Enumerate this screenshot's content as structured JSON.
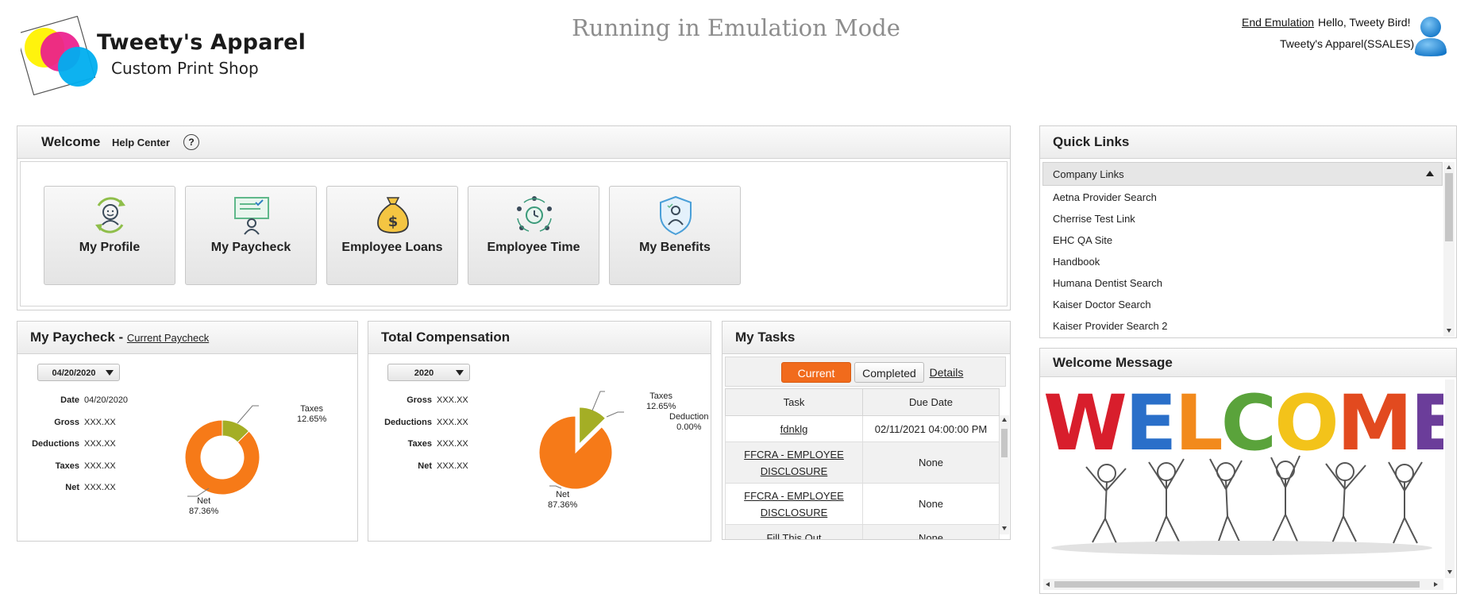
{
  "header": {
    "logo_title": "Tweety's Apparel",
    "logo_subtitle": "Custom Print Shop",
    "emulation_banner": "Running in Emulation Mode",
    "end_emulation": "End Emulation",
    "greeting": "Hello, Tweety Bird!",
    "company": "Tweety's Apparel(SSALES)"
  },
  "welcome": {
    "title": "Welcome",
    "help_center": "Help Center",
    "help_icon_glyph": "?",
    "tiles": [
      {
        "label": "My Profile",
        "icon": "profile-icon"
      },
      {
        "label": "My Paycheck",
        "icon": "paycheck-icon"
      },
      {
        "label": "Employee Loans",
        "icon": "money-bag-icon"
      },
      {
        "label": "Employee Time",
        "icon": "clock-team-icon"
      },
      {
        "label": "My Benefits",
        "icon": "shield-person-icon"
      }
    ]
  },
  "paycheck": {
    "title": "My Paycheck - ",
    "link": "Current Paycheck",
    "selected_date": "04/20/2020",
    "rows": [
      {
        "label": "Date",
        "value": "04/20/2020"
      },
      {
        "label": "Gross",
        "value": "XXX.XX"
      },
      {
        "label": "Deductions",
        "value": "XXX.XX"
      },
      {
        "label": "Taxes",
        "value": "XXX.XX"
      },
      {
        "label": "Net",
        "value": "XXX.XX"
      }
    ]
  },
  "compensation": {
    "title": "Total Compensation",
    "selected_year": "2020",
    "rows": [
      {
        "label": "Gross",
        "value": "XXX.XX"
      },
      {
        "label": "Deductions",
        "value": "XXX.XX"
      },
      {
        "label": "Taxes",
        "value": "XXX.XX"
      },
      {
        "label": "Net",
        "value": "XXX.XX"
      }
    ]
  },
  "chart_data": [
    {
      "type": "pie",
      "variant": "donut",
      "slices": [
        {
          "label": "Taxes",
          "value": 12.65,
          "display": "12.65%",
          "color": "#a4ae25"
        },
        {
          "label": "Net",
          "value": 87.36,
          "display": "87.36%",
          "color": "#f67a18"
        }
      ]
    },
    {
      "type": "pie",
      "variant": "exploded",
      "slices": [
        {
          "label": "Taxes",
          "value": 12.65,
          "display": "12.65%",
          "color": "#a4ae25"
        },
        {
          "label": "Deduction",
          "value": 0.0,
          "display": "0.00%",
          "color": "#2d2d2d"
        },
        {
          "label": "Net",
          "value": 87.36,
          "display": "87.36%",
          "color": "#f67a18"
        }
      ]
    }
  ],
  "tasks": {
    "title": "My Tasks",
    "tab_current": "Current",
    "tab_completed": "Completed",
    "details_link": "Details",
    "columns": [
      "Task",
      "Due Date"
    ],
    "rows": [
      {
        "task": "fdnklg",
        "due": "02/11/2021 04:00:00 PM"
      },
      {
        "task": "FFCRA - EMPLOYEE DISCLOSURE",
        "due": "None"
      },
      {
        "task": "FFCRA - EMPLOYEE DISCLOSURE",
        "due": "None"
      },
      {
        "task": "Fill This Out",
        "due": "None"
      }
    ]
  },
  "quick_links": {
    "title": "Quick Links",
    "group": "Company Links",
    "items": [
      "Aetna Provider Search",
      "Cherrise Test Link",
      "EHC QA Site",
      "Handbook",
      "Humana Dentist Search",
      "Kaiser Doctor Search",
      "Kaiser Provider Search 2"
    ]
  },
  "welcome_message": {
    "title": "Welcome Message",
    "image_text": "WELCOME",
    "letter_colors": [
      "#d81e2c",
      "#2a6fc9",
      "#f28a1c",
      "#5aa33b",
      "#f3c31a",
      "#e24a1f",
      "#6b3d9a"
    ]
  },
  "colors": {
    "accent_orange": "#f16b1c",
    "taxes_olive": "#a4ae25",
    "net_orange": "#f67a18"
  }
}
